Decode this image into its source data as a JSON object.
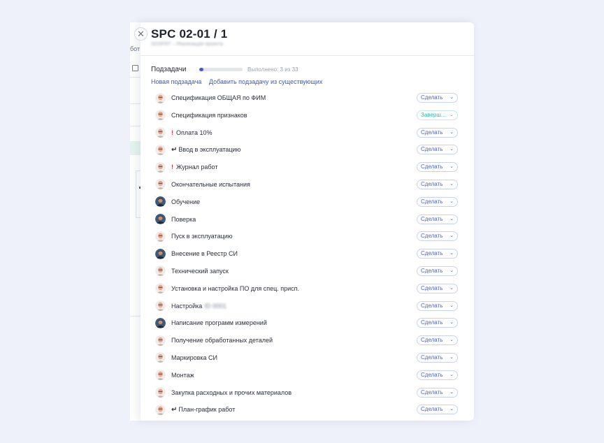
{
  "background": {
    "fragment_text": "бот"
  },
  "panel": {
    "title": "SPC 02-01 / 1",
    "subtitle": "SOSPRT – Реализация проекта"
  },
  "subtasks": {
    "heading": "Подзадачи",
    "progress_fraction": 0.091,
    "progress_text": "Выполнено: 3 из 33",
    "new_link": "Новая подзадача",
    "add_existing_link": "Добавить подзадачу из существующих",
    "items": [
      {
        "label": "Спецификация ОБЩАЯ по ФИМ",
        "prefix": "",
        "avatar": "light",
        "status": "Сделать",
        "done": false
      },
      {
        "label": "Спецификация признаков",
        "prefix": "",
        "avatar": "light",
        "status": "Заверш...",
        "done": true
      },
      {
        "label": "Оплата 10%",
        "prefix": "!",
        "avatar": "light",
        "status": "Сделать",
        "done": false
      },
      {
        "label": "Ввод в эксплуатацию",
        "prefix": "↵",
        "avatar": "light",
        "status": "Сделать",
        "done": false
      },
      {
        "label": "Журнал работ",
        "prefix": "!",
        "avatar": "light",
        "status": "Сделать",
        "done": false
      },
      {
        "label": "Окончательные испытания",
        "prefix": "",
        "avatar": "light",
        "status": "Сделать",
        "done": false
      },
      {
        "label": "Обучение",
        "prefix": "",
        "avatar": "dark",
        "status": "Сделать",
        "done": false
      },
      {
        "label": "Поверка",
        "prefix": "",
        "avatar": "dark",
        "status": "Сделать",
        "done": false
      },
      {
        "label": "Пуск в эксплуатацию",
        "prefix": "",
        "avatar": "light",
        "status": "Сделать",
        "done": false
      },
      {
        "label": "Внесение в Реестр СИ",
        "prefix": "",
        "avatar": "dark",
        "status": "Сделать",
        "done": false
      },
      {
        "label": "Технический запуск",
        "prefix": "",
        "avatar": "light",
        "status": "Сделать",
        "done": false
      },
      {
        "label": "Установка и настройка ПО для спец. присп.",
        "prefix": "",
        "avatar": "light",
        "status": "Сделать",
        "done": false
      },
      {
        "label": "Настройка",
        "prefix": "",
        "avatar": "light",
        "status": "Сделать",
        "done": false,
        "blurred": "ID 0001"
      },
      {
        "label": "Написание программ измерений",
        "prefix": "",
        "avatar": "dark",
        "status": "Сделать",
        "done": false
      },
      {
        "label": "Получение обработанных деталей",
        "prefix": "",
        "avatar": "light",
        "status": "Сделать",
        "done": false
      },
      {
        "label": "Маркировка СИ",
        "prefix": "",
        "avatar": "light",
        "status": "Сделать",
        "done": false
      },
      {
        "label": "Монтаж",
        "prefix": "",
        "avatar": "light",
        "status": "Сделать",
        "done": false
      },
      {
        "label": "Закупка расходных и прочих материалов",
        "prefix": "",
        "avatar": "light",
        "status": "Сделать",
        "done": false
      },
      {
        "label": "План-график работ",
        "prefix": "↵",
        "avatar": "light",
        "status": "Сделать",
        "done": false
      }
    ]
  },
  "colors": {
    "accent": "#3f55d1",
    "done": "#2fb3a2",
    "warning": "#e0324b"
  }
}
